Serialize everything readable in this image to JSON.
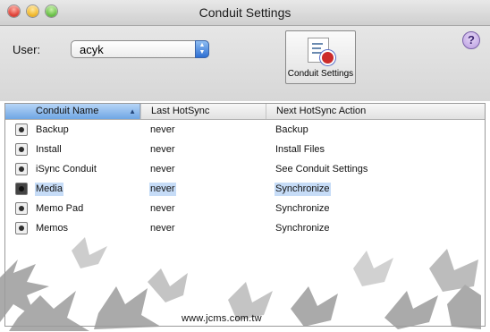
{
  "window": {
    "title": "Conduit Settings"
  },
  "toolbar": {
    "user_label": "User:",
    "user_value": "acyk",
    "conduit_button_label": "Conduit Settings",
    "help_label": "?"
  },
  "table": {
    "columns": [
      "Conduit Name",
      "Last HotSync",
      "Next HotSync Action"
    ],
    "rows": [
      {
        "name": "Backup",
        "last": "never",
        "action": "Backup",
        "selected": false
      },
      {
        "name": "Install",
        "last": "never",
        "action": "Install Files",
        "selected": false
      },
      {
        "name": "iSync Conduit",
        "last": "never",
        "action": "See Conduit Settings",
        "selected": false
      },
      {
        "name": "Media",
        "last": "never",
        "action": "Synchronize",
        "selected": true
      },
      {
        "name": "Memo Pad",
        "last": "never",
        "action": "Synchronize",
        "selected": false
      },
      {
        "name": "Memos",
        "last": "never",
        "action": "Synchronize",
        "selected": false
      }
    ]
  },
  "footer": {
    "watermark": "www.jcms.com.tw"
  },
  "colors": {
    "accent": "#3a7ad8",
    "selection": "#c6dcf7"
  }
}
